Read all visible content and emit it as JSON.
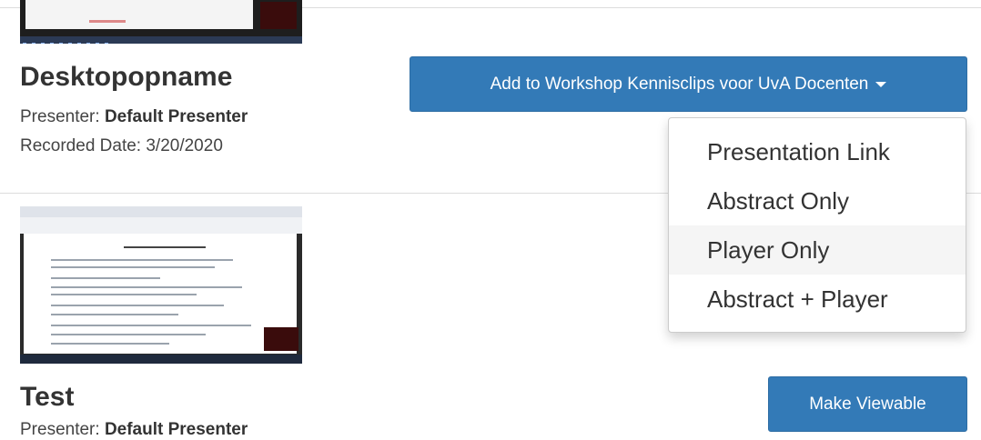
{
  "recordings": [
    {
      "title": "Desktopopname",
      "presenter_label": "Presenter:",
      "presenter": "Default Presenter",
      "recorded_label": "Recorded Date:",
      "recorded_date": "3/20/2020",
      "action_label": "Add to Workshop Kennisclips voor UvA Docenten"
    },
    {
      "title": "Test",
      "presenter_label": "Presenter:",
      "presenter": "Default Presenter",
      "action_label": "Make Viewable"
    }
  ],
  "dropdown": {
    "items": [
      "Presentation Link",
      "Abstract Only",
      "Player Only",
      "Abstract + Player"
    ],
    "hovered": "Player Only"
  },
  "colors": {
    "button": "#337ab7",
    "button_text": "#ffffff",
    "hover_bg": "#f5f5f5"
  },
  "icons": {
    "dropdown_caret": "caret-down-icon"
  }
}
